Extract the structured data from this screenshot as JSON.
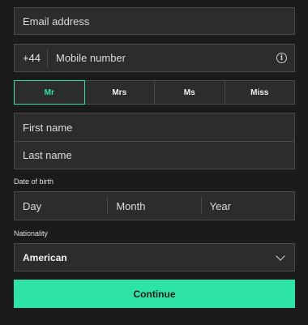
{
  "email": {
    "placeholder": "Email address"
  },
  "phone": {
    "prefix": "+44",
    "placeholder": "Mobile number",
    "info_icon": "info-circle-icon",
    "info_glyph": "i"
  },
  "titles": [
    {
      "label": "Mr",
      "selected": true
    },
    {
      "label": "Mrs",
      "selected": false
    },
    {
      "label": "Ms",
      "selected": false
    },
    {
      "label": "Miss",
      "selected": false
    }
  ],
  "names": {
    "first": "First name",
    "last": "Last name"
  },
  "dob": {
    "label": "Date of birth",
    "day": "Day",
    "month": "Month",
    "year": "Year"
  },
  "nationality": {
    "label": "Nationality",
    "value": "American",
    "chevron_icon": "chevron-down-icon"
  },
  "cta": {
    "label": "Continue"
  },
  "colors": {
    "accent": "#2de3a5",
    "background": "#1b1b1b",
    "field": "#2c2c2c",
    "border": "#4a4a4a"
  }
}
